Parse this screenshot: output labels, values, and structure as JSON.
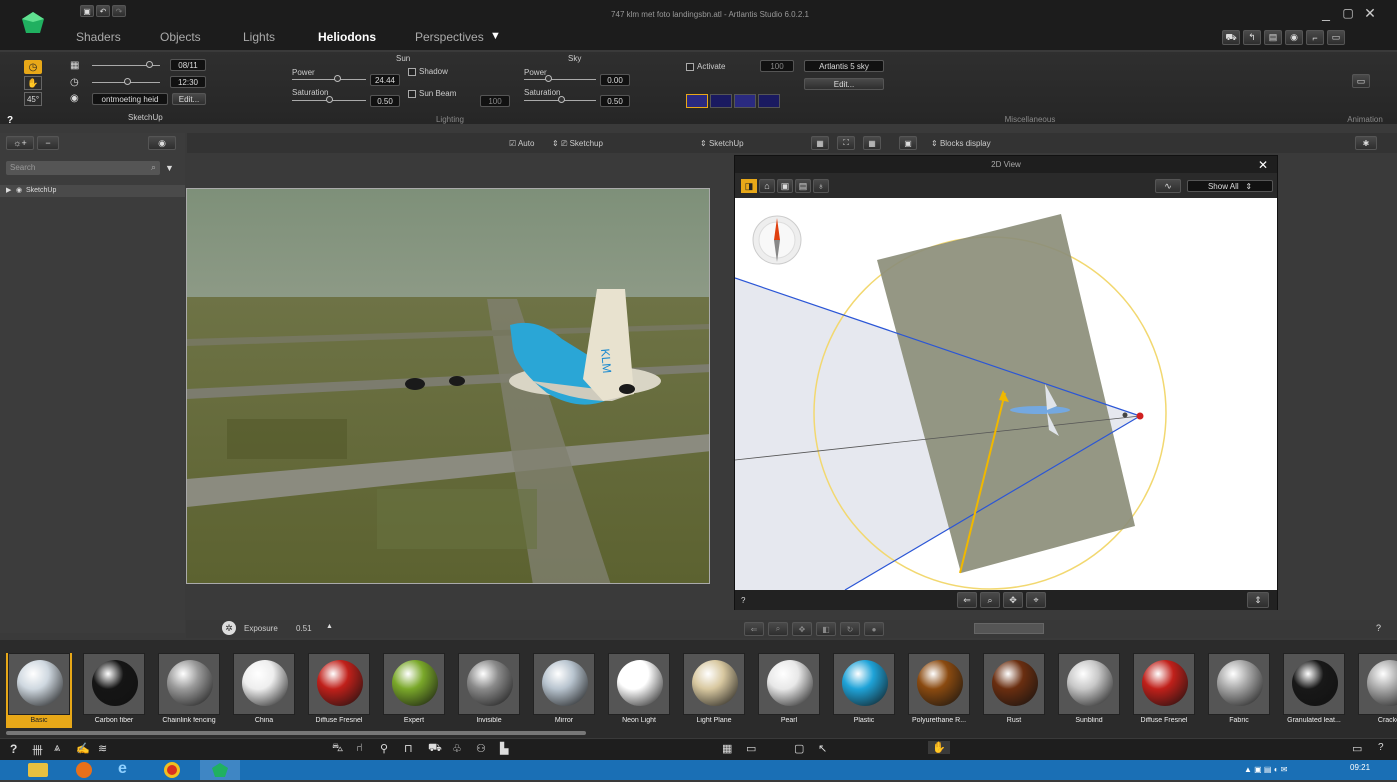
{
  "window": {
    "title": "747 klm met foto landingsbn.atl - Artlantis Studio 6.0.2.1"
  },
  "tabs": [
    {
      "label": "Shaders"
    },
    {
      "label": "Objects"
    },
    {
      "label": "Lights"
    },
    {
      "label": "Heliodons"
    },
    {
      "label": "Perspectives"
    }
  ],
  "ribbon": {
    "date": "08/11",
    "time": "12:30",
    "angle": "45°",
    "location": "ontmoeting heid",
    "edit_label": "Edit...",
    "group_label": "SketchUp",
    "sun": {
      "title": "Sun",
      "power_label": "Power",
      "power_value": "24.44",
      "saturation_label": "Saturation",
      "saturation_value": "0.50",
      "shadow_label": "Shadow",
      "sunbeam_label": "Sun Beam",
      "sunbeam_value": "100"
    },
    "sky": {
      "title": "Sky",
      "power_label": "Power",
      "power_value": "0.00",
      "saturation_label": "Saturation",
      "saturation_value": "0.50"
    },
    "lighting_label": "Lighting",
    "misc": {
      "activate_label": "Activate",
      "activate_value": "100",
      "sky_select": "Artlantis 5 sky",
      "edit_label": "Edit...",
      "label": "Miscellaneous"
    },
    "animation_label": "Animation",
    "help": "?"
  },
  "sidebar": {
    "search_placeholder": "Search",
    "tree_item": "SketchUp"
  },
  "viewbar": {
    "auto_label": "Auto",
    "sketchup1": "Sketchup",
    "sketchup2": "SketchUp",
    "blocks": "Blocks display"
  },
  "view2d": {
    "title": "2D View",
    "show_all": "Show All",
    "help": "?"
  },
  "exposure": {
    "label": "Exposure",
    "value": "0.51"
  },
  "help_right": "?",
  "shaders": [
    {
      "name": "Basic",
      "color": "#cfd8e0"
    },
    {
      "name": "Carbon fiber",
      "color": "#151515"
    },
    {
      "name": "Chainlink fencing",
      "color": "#9a9a9a"
    },
    {
      "name": "China",
      "color": "#eeeeee"
    },
    {
      "name": "Diffuse Fresnel",
      "color": "#c0201a"
    },
    {
      "name": "Expert",
      "color": "#7aa82a"
    },
    {
      "name": "Invisible",
      "color": "#8a8a8a"
    },
    {
      "name": "Mirror",
      "color": "#b8c4cf"
    },
    {
      "name": "Neon Light",
      "color": "#ffffff"
    },
    {
      "name": "Light Plane",
      "color": "#d8c8a0"
    },
    {
      "name": "Pearl",
      "color": "#e8e8e8"
    },
    {
      "name": "Plastic",
      "color": "#1fa3d8"
    },
    {
      "name": "Polyurethane R...",
      "color": "#8a4a10"
    },
    {
      "name": "Rust",
      "color": "#6a2e10"
    },
    {
      "name": "Sunblind",
      "color": "#c8c8c8"
    },
    {
      "name": "Diffuse Fresnel",
      "color": "#c0201a"
    },
    {
      "name": "Fabric",
      "color": "#a8a8a8"
    },
    {
      "name": "Granulated leat...",
      "color": "#181818"
    },
    {
      "name": "Cracke",
      "color": "#aaaaaa"
    }
  ],
  "tray": {
    "time": "09:21"
  }
}
